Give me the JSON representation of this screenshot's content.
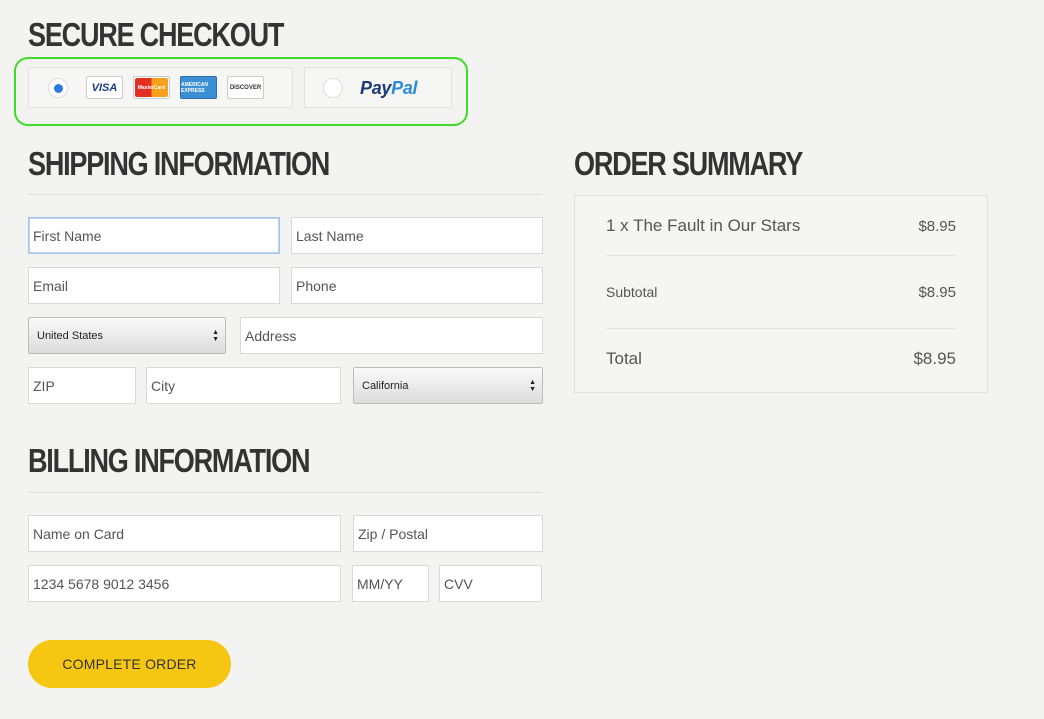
{
  "checkout": {
    "title": "Secure Checkout",
    "cards": {
      "visa": "VISA",
      "mastercard": "MasterCard",
      "amex": "AMERICAN EXPRESS",
      "discover": "DISCOVER"
    },
    "paypal_part1": "Pay",
    "paypal_part2": "Pal",
    "selected_method": "card"
  },
  "shipping": {
    "title": "Shipping Information",
    "first_name_placeholder": "First Name",
    "last_name_placeholder": "Last Name",
    "email_placeholder": "Email",
    "phone_placeholder": "Phone",
    "country": "United States",
    "address_placeholder": "Address",
    "zip_placeholder": "ZIP",
    "city_placeholder": "City",
    "state": "California"
  },
  "billing": {
    "title": "Billing Information",
    "name_on_card_placeholder": "Name on Card",
    "zip_postal_placeholder": "Zip / Postal",
    "card_number_placeholder": "1234 5678 9012 3456",
    "expiry_placeholder": "MM/YY",
    "cvv_placeholder": "CVV"
  },
  "summary": {
    "title": "Order Summary",
    "item_label": "1 x The Fault in Our Stars",
    "item_price": "$8.95",
    "subtotal_label": "Subtotal",
    "subtotal_value": "$8.95",
    "total_label": "Total",
    "total_value": "$8.95"
  },
  "actions": {
    "complete_order": "Complete Order"
  }
}
